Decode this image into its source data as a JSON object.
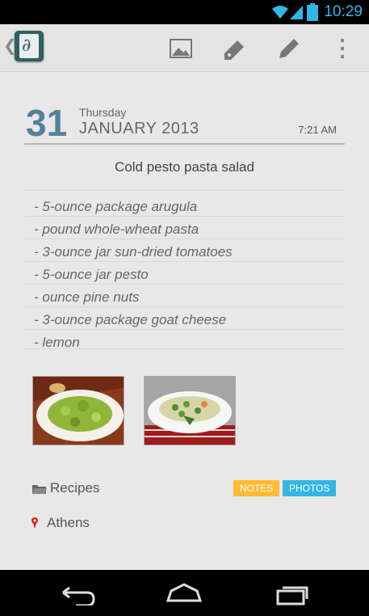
{
  "status": {
    "time": "10:29"
  },
  "actionbar": {
    "icons": [
      "back-chevron-icon",
      "diary-app-icon",
      "image-icon",
      "tag-icon",
      "edit-icon",
      "overflow-menu-icon"
    ]
  },
  "entry": {
    "day": "31",
    "weekday": "Thursday",
    "month_year": "JANUARY 2013",
    "time": "7:21 AM",
    "title": "Cold pesto pasta salad",
    "ingredients": [
      "- 5-ounce package arugula",
      "- pound whole-wheat pasta",
      "- 3-ounce jar sun-dried tomatoes",
      "- 5-ounce jar pesto",
      "- ounce pine nuts",
      "- 3-ounce package goat cheese",
      "- lemon"
    ],
    "category": "Recipes",
    "location": "Athens",
    "tags": [
      {
        "label": "NOTES",
        "color": "#ffbb33"
      },
      {
        "label": "PHOTOS",
        "color": "#33b5e5"
      }
    ]
  },
  "colors": {
    "accent": "#33b5e5",
    "date": "#54809a",
    "notes_tag": "#ffbb33"
  }
}
